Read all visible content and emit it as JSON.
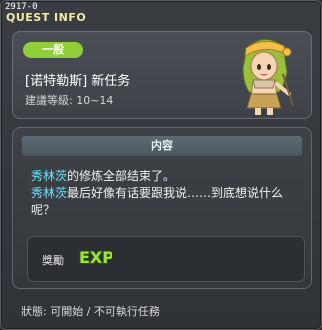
{
  "window": {
    "quest_id": "2917-0",
    "title": "QUEST INFO",
    "close_glyph": "✕"
  },
  "quest": {
    "category_badge": "一般",
    "name": "[诺特勒斯] 新任务",
    "level_range": "建議等級: 10~14"
  },
  "content": {
    "title": "内容",
    "lines": [
      {
        "highlight": "秀林茨",
        "text": "的修炼全部结束了。"
      },
      {
        "highlight": "秀林茨",
        "text": "最后好像有话要跟我说……到底想说什么呢？"
      }
    ]
  },
  "reward": {
    "label": "獎勵",
    "exp_text": "EXP",
    "exp_color": "#9be52d"
  },
  "status": "狀態: 可開始 / 不可執行任務",
  "colors": {
    "accent_badge": "#8fcf3a",
    "highlight_text": "#66e7ff",
    "title_text": "#f3e9a8"
  },
  "icons": {
    "npc": "npc-portrait-icon",
    "exp": "exp-icon"
  }
}
